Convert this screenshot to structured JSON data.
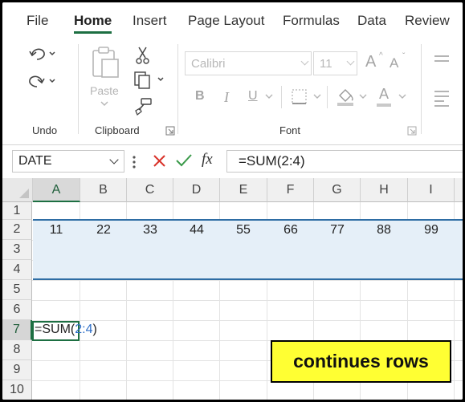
{
  "menu": {
    "tabs": [
      "File",
      "Home",
      "Insert",
      "Page Layout",
      "Formulas",
      "Data",
      "Review"
    ],
    "active_tab": "Home",
    "accent_color": "#1d6f42"
  },
  "ribbon": {
    "undo": {
      "group_label": "Undo",
      "undo_icon": "undo-icon",
      "redo_icon": "redo-icon"
    },
    "clipboard": {
      "group_label": "Clipboard",
      "paste_label": "Paste",
      "icons": [
        "paste-icon",
        "cut-icon",
        "copy-icon",
        "format-painter-icon"
      ]
    },
    "font": {
      "group_label": "Font",
      "font_name": "Calibri",
      "font_size": "11",
      "grow_label": "A",
      "shrink_label": "A",
      "bold_label": "B",
      "italic_label": "I",
      "underline_label": "U",
      "font_color_label": "A"
    }
  },
  "formula_bar": {
    "name_box": "DATE",
    "fx_label": "fx",
    "formula": "=SUM(2:4)"
  },
  "grid": {
    "columns": [
      "A",
      "B",
      "C",
      "D",
      "E",
      "F",
      "G",
      "H",
      "I"
    ],
    "selected_column": "A",
    "rows": [
      "1",
      "2",
      "3",
      "4",
      "5",
      "6",
      "7",
      "8",
      "9",
      "10"
    ],
    "selected_row": "7",
    "row2_values": [
      "11",
      "22",
      "33",
      "44",
      "55",
      "66",
      "77",
      "88",
      "99"
    ],
    "active_cell_prefix": "=SUM(",
    "active_cell_ref": "2:4",
    "active_cell_suffix": ")",
    "highlight_color": "#e5eff8",
    "range_border_color": "#2e6da4"
  },
  "callout": {
    "text": "continues rows",
    "background": "#ffff33"
  }
}
